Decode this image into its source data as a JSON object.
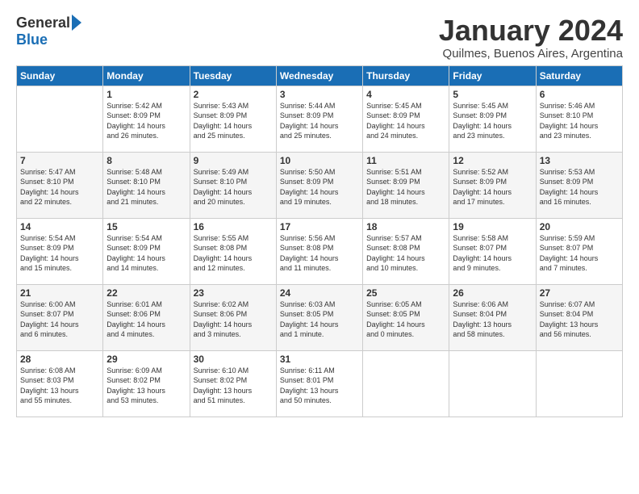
{
  "logo": {
    "general": "General",
    "blue": "Blue"
  },
  "header": {
    "month_title": "January 2024",
    "subtitle": "Quilmes, Buenos Aires, Argentina"
  },
  "days_of_week": [
    "Sunday",
    "Monday",
    "Tuesday",
    "Wednesday",
    "Thursday",
    "Friday",
    "Saturday"
  ],
  "weeks": [
    [
      {
        "num": "",
        "info": ""
      },
      {
        "num": "1",
        "info": "Sunrise: 5:42 AM\nSunset: 8:09 PM\nDaylight: 14 hours\nand 26 minutes."
      },
      {
        "num": "2",
        "info": "Sunrise: 5:43 AM\nSunset: 8:09 PM\nDaylight: 14 hours\nand 25 minutes."
      },
      {
        "num": "3",
        "info": "Sunrise: 5:44 AM\nSunset: 8:09 PM\nDaylight: 14 hours\nand 25 minutes."
      },
      {
        "num": "4",
        "info": "Sunrise: 5:45 AM\nSunset: 8:09 PM\nDaylight: 14 hours\nand 24 minutes."
      },
      {
        "num": "5",
        "info": "Sunrise: 5:45 AM\nSunset: 8:09 PM\nDaylight: 14 hours\nand 23 minutes."
      },
      {
        "num": "6",
        "info": "Sunrise: 5:46 AM\nSunset: 8:10 PM\nDaylight: 14 hours\nand 23 minutes."
      }
    ],
    [
      {
        "num": "7",
        "info": "Sunrise: 5:47 AM\nSunset: 8:10 PM\nDaylight: 14 hours\nand 22 minutes."
      },
      {
        "num": "8",
        "info": "Sunrise: 5:48 AM\nSunset: 8:10 PM\nDaylight: 14 hours\nand 21 minutes."
      },
      {
        "num": "9",
        "info": "Sunrise: 5:49 AM\nSunset: 8:10 PM\nDaylight: 14 hours\nand 20 minutes."
      },
      {
        "num": "10",
        "info": "Sunrise: 5:50 AM\nSunset: 8:09 PM\nDaylight: 14 hours\nand 19 minutes."
      },
      {
        "num": "11",
        "info": "Sunrise: 5:51 AM\nSunset: 8:09 PM\nDaylight: 14 hours\nand 18 minutes."
      },
      {
        "num": "12",
        "info": "Sunrise: 5:52 AM\nSunset: 8:09 PM\nDaylight: 14 hours\nand 17 minutes."
      },
      {
        "num": "13",
        "info": "Sunrise: 5:53 AM\nSunset: 8:09 PM\nDaylight: 14 hours\nand 16 minutes."
      }
    ],
    [
      {
        "num": "14",
        "info": "Sunrise: 5:54 AM\nSunset: 8:09 PM\nDaylight: 14 hours\nand 15 minutes."
      },
      {
        "num": "15",
        "info": "Sunrise: 5:54 AM\nSunset: 8:09 PM\nDaylight: 14 hours\nand 14 minutes."
      },
      {
        "num": "16",
        "info": "Sunrise: 5:55 AM\nSunset: 8:08 PM\nDaylight: 14 hours\nand 12 minutes."
      },
      {
        "num": "17",
        "info": "Sunrise: 5:56 AM\nSunset: 8:08 PM\nDaylight: 14 hours\nand 11 minutes."
      },
      {
        "num": "18",
        "info": "Sunrise: 5:57 AM\nSunset: 8:08 PM\nDaylight: 14 hours\nand 10 minutes."
      },
      {
        "num": "19",
        "info": "Sunrise: 5:58 AM\nSunset: 8:07 PM\nDaylight: 14 hours\nand 9 minutes."
      },
      {
        "num": "20",
        "info": "Sunrise: 5:59 AM\nSunset: 8:07 PM\nDaylight: 14 hours\nand 7 minutes."
      }
    ],
    [
      {
        "num": "21",
        "info": "Sunrise: 6:00 AM\nSunset: 8:07 PM\nDaylight: 14 hours\nand 6 minutes."
      },
      {
        "num": "22",
        "info": "Sunrise: 6:01 AM\nSunset: 8:06 PM\nDaylight: 14 hours\nand 4 minutes."
      },
      {
        "num": "23",
        "info": "Sunrise: 6:02 AM\nSunset: 8:06 PM\nDaylight: 14 hours\nand 3 minutes."
      },
      {
        "num": "24",
        "info": "Sunrise: 6:03 AM\nSunset: 8:05 PM\nDaylight: 14 hours\nand 1 minute."
      },
      {
        "num": "25",
        "info": "Sunrise: 6:05 AM\nSunset: 8:05 PM\nDaylight: 14 hours\nand 0 minutes."
      },
      {
        "num": "26",
        "info": "Sunrise: 6:06 AM\nSunset: 8:04 PM\nDaylight: 13 hours\nand 58 minutes."
      },
      {
        "num": "27",
        "info": "Sunrise: 6:07 AM\nSunset: 8:04 PM\nDaylight: 13 hours\nand 56 minutes."
      }
    ],
    [
      {
        "num": "28",
        "info": "Sunrise: 6:08 AM\nSunset: 8:03 PM\nDaylight: 13 hours\nand 55 minutes."
      },
      {
        "num": "29",
        "info": "Sunrise: 6:09 AM\nSunset: 8:02 PM\nDaylight: 13 hours\nand 53 minutes."
      },
      {
        "num": "30",
        "info": "Sunrise: 6:10 AM\nSunset: 8:02 PM\nDaylight: 13 hours\nand 51 minutes."
      },
      {
        "num": "31",
        "info": "Sunrise: 6:11 AM\nSunset: 8:01 PM\nDaylight: 13 hours\nand 50 minutes."
      },
      {
        "num": "",
        "info": ""
      },
      {
        "num": "",
        "info": ""
      },
      {
        "num": "",
        "info": ""
      }
    ]
  ]
}
